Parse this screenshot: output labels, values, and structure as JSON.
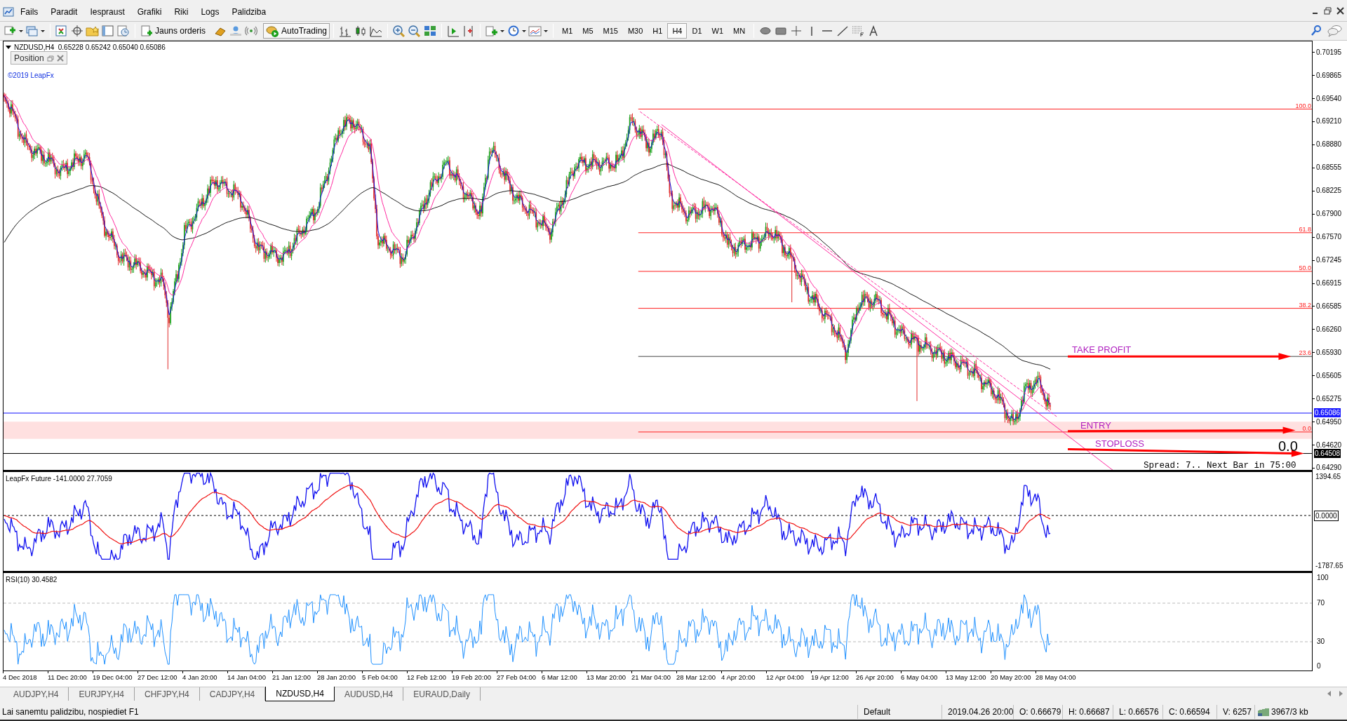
{
  "menu": [
    "Fails",
    "Paradit",
    "Iespraust",
    "Grafiki",
    "Riki",
    "Logs",
    "Palidziba"
  ],
  "toolbar": {
    "new_order": "Jauns orderis",
    "autotrading": "AutoTrading",
    "timeframes": [
      {
        "label": "M1",
        "selected": false
      },
      {
        "label": "M5",
        "selected": false
      },
      {
        "label": "M15",
        "selected": false
      },
      {
        "label": "M30",
        "selected": false
      },
      {
        "label": "H1",
        "selected": false
      },
      {
        "label": "H4",
        "selected": true
      },
      {
        "label": "D1",
        "selected": false
      },
      {
        "label": "W1",
        "selected": false
      },
      {
        "label": "MN",
        "selected": false
      }
    ]
  },
  "chart": {
    "header": "NZDUSD,H4  0.65228 0.65242 0.65040 0.65086",
    "position_panel": "Position",
    "copyright": "©2019 LeapFx",
    "price_axis": [
      "0.70195",
      "0.69865",
      "0.69540",
      "0.69210",
      "0.68880",
      "0.68555",
      "0.68225",
      "0.67900",
      "0.67570",
      "0.67245",
      "0.66915",
      "0.66585",
      "0.66260",
      "0.65930",
      "0.65605",
      "0.65275",
      "0.64950",
      "0.64620",
      "0.64290"
    ],
    "current_price": "0.65086",
    "stop_price": "0.64508",
    "fib_levels": [
      "100.0",
      "61.8",
      "50.0",
      "38.2",
      "23.6",
      "0.0"
    ],
    "take_profit": "TAKE PROFIT",
    "entry": "ENTRY",
    "stoploss": "STOPLOSS",
    "counter": "0.0",
    "info": "Spread: 7.. Next Bar in 75:00"
  },
  "indicator": {
    "title": "LeapFx Future -141.0000 27.7059",
    "axis": [
      "1394.65",
      "0.0000",
      "-1787.65"
    ]
  },
  "rsi": {
    "title": "RSI(10) 30.4582",
    "axis": [
      "100",
      "70",
      "30",
      "0"
    ]
  },
  "time_axis": [
    "4 Dec 2018",
    "11 Dec 20:00",
    "19 Dec 04:00",
    "27 Dec 12:00",
    "4 Jan 20:00",
    "14 Jan 04:00",
    "21 Jan 12:00",
    "28 Jan 20:00",
    "5 Feb 04:00",
    "12 Feb 12:00",
    "19 Feb 20:00",
    "27 Feb 04:00",
    "6 Mar 12:00",
    "13 Mar 20:00",
    "21 Mar 04:00",
    "28 Mar 12:00",
    "4 Apr 20:00",
    "12 Apr 04:00",
    "19 Apr 12:00",
    "26 Apr 20:00",
    "6 May 04:00",
    "13 May 12:00",
    "20 May 20:00",
    "28 May 04:00"
  ],
  "tabs": [
    {
      "label": "AUDJPY,H4",
      "selected": false
    },
    {
      "label": "EURJPY,H4",
      "selected": false
    },
    {
      "label": "CHFJPY,H4",
      "selected": false
    },
    {
      "label": "CADJPY,H4",
      "selected": false
    },
    {
      "label": "NZDUSD,H4",
      "selected": true
    },
    {
      "label": "AUDUSD,H4",
      "selected": false
    },
    {
      "label": "EURAUD,Daily",
      "selected": false
    }
  ],
  "status_bar": {
    "help": "Lai sanemtu palidzibu, nospiediet F1",
    "profile": "Default",
    "time": "2019.04.26 20:00",
    "open": "O: 0.66679",
    "high": "H: 0.66687",
    "low": "L: 0.66576",
    "close": "C: 0.66594",
    "volume": "V: 6257",
    "traffic": "3967/3 kb"
  }
}
